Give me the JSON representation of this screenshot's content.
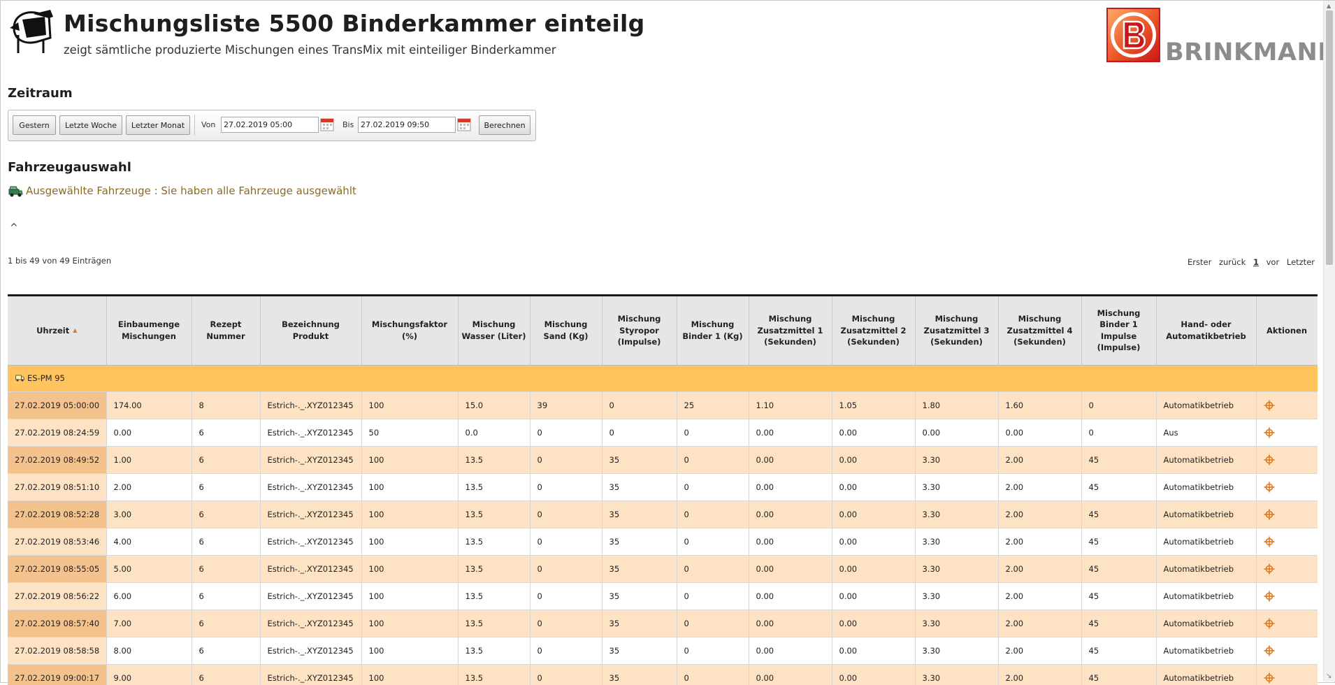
{
  "header": {
    "title": "Mischungsliste 5500 Binderkammer einteilg",
    "subtitle": "zeigt sämtliche produzierte Mischungen eines TransMix mit einteiliger Binderkammer",
    "logo_text": "BRINKMANN"
  },
  "zeitraum": {
    "title": "Zeitraum",
    "buttons": {
      "gestern": "Gestern",
      "letzte_woche": "Letzte Woche",
      "letzter_monat": "Letzter Monat",
      "berechnen": "Berechnen"
    },
    "von_label": "Von",
    "bis_label": "Bis",
    "von_value": "27.02.2019 05:00",
    "bis_value": "27.02.2019 09:50"
  },
  "fahrzeug": {
    "title": "Fahrzeugauswahl",
    "selected_text": "Ausgewählte Fahrzeuge : Sie haben alle Fahrzeuge ausgewählt"
  },
  "collapse_caret": "^",
  "paging": {
    "info": "1 bis 49 von 49 Einträgen",
    "first": "Erster",
    "prev": "zurück",
    "current": "1",
    "next": "vor",
    "last": "Letzter"
  },
  "table": {
    "columns": [
      "Uhrzeit",
      "Einbaumenge Mischungen",
      "Rezept Nummer",
      "Bezeichnung Produkt",
      "Mischungsfaktor (%)",
      "Mischung Wasser (Liter)",
      "Mischung Sand (Kg)",
      "Mischung Styropor (Impulse)",
      "Mischung Binder 1 (Kg)",
      "Mischung Zusatzmittel 1 (Sekunden)",
      "Mischung Zusatzmittel 2 (Sekunden)",
      "Mischung Zusatzmittel 3 (Sekunden)",
      "Mischung Zusatzmittel 4 (Sekunden)",
      "Mischung Binder 1 Impulse (Impulse)",
      "Hand- oder Automatikbetrieb",
      "Aktionen"
    ],
    "group_label": "ES-PM 95",
    "rows": [
      [
        "27.02.2019 05:00:00",
        "174.00",
        "8",
        "Estrich-._.XYZ012345",
        "100",
        "15.0",
        "39",
        "0",
        "25",
        "1.10",
        "1.05",
        "1.80",
        "1.60",
        "0",
        "Automatikbetrieb"
      ],
      [
        "27.02.2019 08:24:59",
        "0.00",
        "6",
        "Estrich-._.XYZ012345",
        "50",
        "0.0",
        "0",
        "0",
        "0",
        "0.00",
        "0.00",
        "0.00",
        "0.00",
        "0",
        "Aus"
      ],
      [
        "27.02.2019 08:49:52",
        "1.00",
        "6",
        "Estrich-._.XYZ012345",
        "100",
        "13.5",
        "0",
        "35",
        "0",
        "0.00",
        "0.00",
        "3.30",
        "2.00",
        "45",
        "Automatikbetrieb"
      ],
      [
        "27.02.2019 08:51:10",
        "2.00",
        "6",
        "Estrich-._.XYZ012345",
        "100",
        "13.5",
        "0",
        "35",
        "0",
        "0.00",
        "0.00",
        "3.30",
        "2.00",
        "45",
        "Automatikbetrieb"
      ],
      [
        "27.02.2019 08:52:28",
        "3.00",
        "6",
        "Estrich-._.XYZ012345",
        "100",
        "13.5",
        "0",
        "35",
        "0",
        "0.00",
        "0.00",
        "3.30",
        "2.00",
        "45",
        "Automatikbetrieb"
      ],
      [
        "27.02.2019 08:53:46",
        "4.00",
        "6",
        "Estrich-._.XYZ012345",
        "100",
        "13.5",
        "0",
        "35",
        "0",
        "0.00",
        "0.00",
        "3.30",
        "2.00",
        "45",
        "Automatikbetrieb"
      ],
      [
        "27.02.2019 08:55:05",
        "5.00",
        "6",
        "Estrich-._.XYZ012345",
        "100",
        "13.5",
        "0",
        "35",
        "0",
        "0.00",
        "0.00",
        "3.30",
        "2.00",
        "45",
        "Automatikbetrieb"
      ],
      [
        "27.02.2019 08:56:22",
        "6.00",
        "6",
        "Estrich-._.XYZ012345",
        "100",
        "13.5",
        "0",
        "35",
        "0",
        "0.00",
        "0.00",
        "3.30",
        "2.00",
        "45",
        "Automatikbetrieb"
      ],
      [
        "27.02.2019 08:57:40",
        "7.00",
        "6",
        "Estrich-._.XYZ012345",
        "100",
        "13.5",
        "0",
        "35",
        "0",
        "0.00",
        "0.00",
        "3.30",
        "2.00",
        "45",
        "Automatikbetrieb"
      ],
      [
        "27.02.2019 08:58:58",
        "8.00",
        "6",
        "Estrich-._.XYZ012345",
        "100",
        "13.5",
        "0",
        "35",
        "0",
        "0.00",
        "0.00",
        "3.30",
        "2.00",
        "45",
        "Automatikbetrieb"
      ],
      [
        "27.02.2019 09:00:17",
        "9.00",
        "6",
        "Estrich-._.XYZ012345",
        "100",
        "13.5",
        "0",
        "35",
        "0",
        "0.00",
        "0.00",
        "3.30",
        "2.00",
        "45",
        "Automatikbetrieb"
      ]
    ]
  },
  "icons": {
    "mixer": "concrete-mixer-icon",
    "logo": "brinkmann-logo",
    "calendar": "calendar-icon",
    "vehicle": "vehicle-icon",
    "truck": "truck-icon",
    "action": "crosshair-target-icon",
    "sort": "sort-ascending-icon"
  },
  "colors": {
    "group_row": "#ffc45e",
    "row_odd": "#fde3c4",
    "time_cell_odd": "#f4c28c",
    "link": "#8a6b22",
    "action_icon": "#e07820",
    "logo_red": "#d8251b"
  }
}
